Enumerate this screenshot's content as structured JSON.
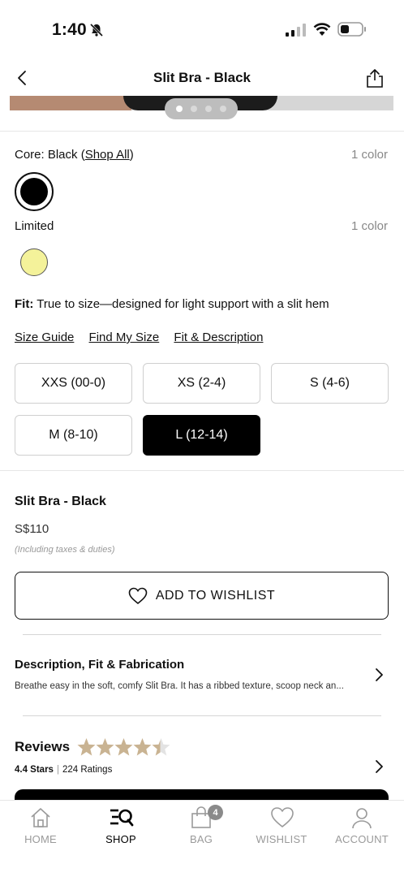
{
  "status_bar": {
    "time": "1:40"
  },
  "header": {
    "title": "Slit Bra - Black"
  },
  "colors": {
    "core": {
      "label": "Core: Black",
      "link": "Shop All",
      "count": "1 color",
      "swatch": "#000000"
    },
    "limited": {
      "label": "Limited",
      "count": "1 color",
      "swatch": "#f4f29a"
    }
  },
  "fit": {
    "label": "Fit:",
    "text": "True to size—designed for light support with a slit hem"
  },
  "size_links": [
    "Size Guide",
    "Find My Size",
    "Fit & Description"
  ],
  "sizes": [
    "XXS (00-0)",
    "XS (2-4)",
    "S (4-6)",
    "M (8-10)",
    "L (12-14)"
  ],
  "selected_size": "L (12-14)",
  "product": {
    "name": "Slit Bra - Black",
    "price": "S$110",
    "tax_note": "(Including taxes & duties)"
  },
  "wishlist_button": {
    "label": "ADD TO WISHLIST"
  },
  "description": {
    "title": "Description, Fit & Fabrication",
    "text": "Breathe easy in the soft, comfy Slit Bra. It has a ribbed texture, scoop neck an..."
  },
  "reviews": {
    "title": "Reviews",
    "rating": "4.4 Stars",
    "ratings_count": "224 Ratings",
    "stars": 4.4
  },
  "tabs": [
    {
      "label": "HOME",
      "icon": "home-icon"
    },
    {
      "label": "SHOP",
      "icon": "shop-icon"
    },
    {
      "label": "BAG",
      "icon": "bag-icon",
      "badge": "4"
    },
    {
      "label": "WISHLIST",
      "icon": "heart-icon"
    },
    {
      "label": "ACCOUNT",
      "icon": "account-icon"
    }
  ],
  "accent_colors": {
    "star": "#c9b392",
    "selected": "#000000",
    "limited_swatch": "#f4f29a"
  }
}
